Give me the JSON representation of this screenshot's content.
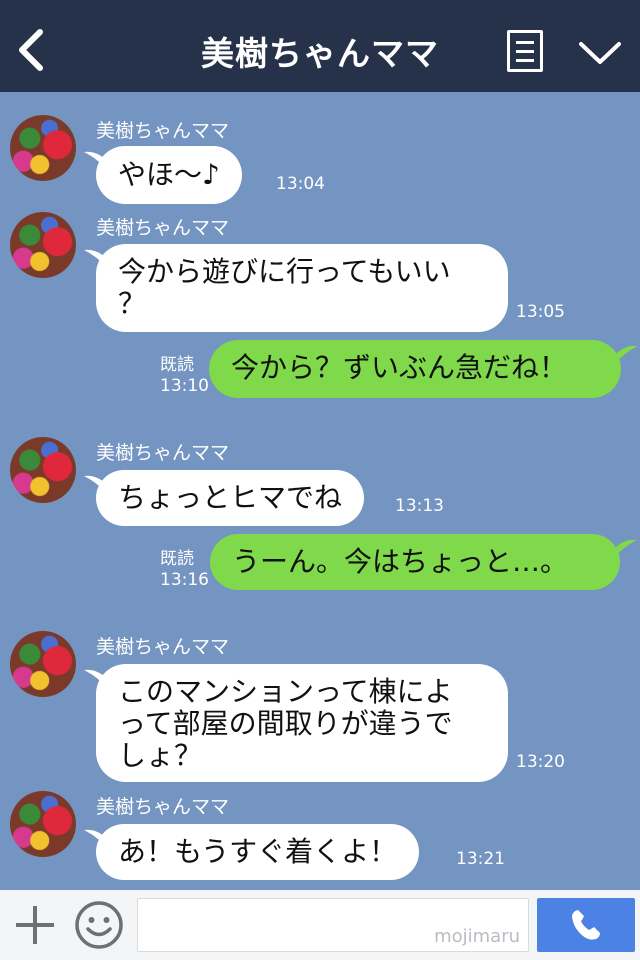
{
  "header": {
    "title": "美樹ちゃんママ",
    "back_icon": "chevron-left-icon",
    "menu_icon": "list-icon",
    "expand_icon": "chevron-down-icon",
    "bg_color": "#263249"
  },
  "chat_bg_color": "#7494c1",
  "messages": [
    {
      "sender": "美樹ちゃんママ",
      "text": "やほ〜♪",
      "time": "13:04"
    },
    {
      "sender": "美樹ちゃんママ",
      "text": "今から遊びに行ってもいい\n？",
      "time": "13:05"
    },
    {
      "read": "既読",
      "time": "13:10",
      "text": "今から？ずいぶん急だね！"
    },
    {
      "sender": "美樹ちゃんママ",
      "text": "ちょっとヒマでね",
      "time": "13:13"
    },
    {
      "read": "既読",
      "time": "13:16",
      "text": "うーん。今はちょっと…。"
    },
    {
      "sender": "美樹ちゃんママ",
      "text": "このマンションって棟によ\nって部屋の間取りが違うで\nしょ？",
      "time": "13:20"
    },
    {
      "sender": "美樹ちゃんママ",
      "text": "あ！もうすぐ着くよ！",
      "time": "13:21"
    }
  ],
  "footer": {
    "add_icon": "plus-icon",
    "sticker_icon": "smile-icon",
    "input_value": "",
    "watermark": "mojimaru",
    "call_icon": "phone-icon",
    "call_color": "#4c82e4"
  },
  "colors": {
    "incoming_bubble": "#ffffff",
    "outgoing_bubble": "#7fd94a"
  }
}
